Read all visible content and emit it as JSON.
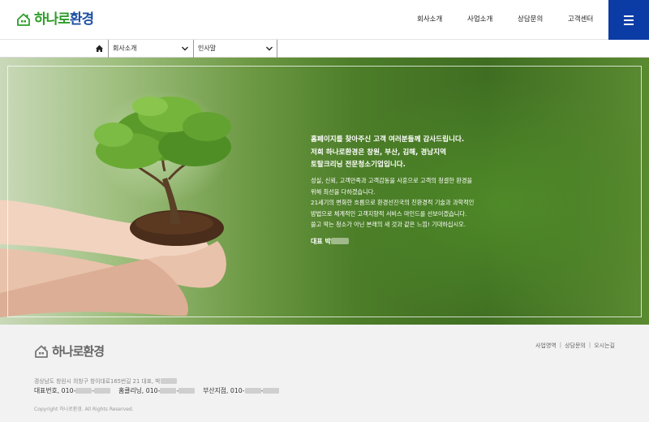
{
  "header": {
    "logo_text": "하나로환경",
    "nav": [
      "회사소개",
      "사업소개",
      "상담문의",
      "고객센터"
    ]
  },
  "subnav": {
    "dropdown1": "회사소개",
    "dropdown2": "인사말"
  },
  "greeting": {
    "headline": [
      "홈페이지를 찾아주신 고객 여러분들께 감사드립니다.",
      "저희 하나로환경은 창원, 부산, 김해, 경남지역",
      "토탈크리닝 전문청소기업입니다."
    ],
    "body": [
      "성실, 신뢰, 고객만족과 고객감동을 사훈으로 고객의 청결한 환경을",
      "위해 최선을 다하겠습니다.",
      "21세기의 변화한 흐름으로 환경선진국의 친환경적 기술과 과학적인",
      "방법으로 체계적인 고객지향적 서비스 마인드를 선보이겠습니다.",
      "쓸고 딱는 청소가 아닌 본래의 새 것과 같은 느낌! 기대하십시오."
    ],
    "sign": "대표 박"
  },
  "footer": {
    "logo_text": "하나로환경",
    "links": [
      "사업영역",
      "상담문의",
      "오시는길"
    ],
    "address": "경상남도 창원시 의창구 창이대로165번길 21   대표, 박",
    "phone1_label": "대표번호, 010-",
    "phone2_label": "홈클리닝, 010-",
    "phone3_label": "부산지점, 010-",
    "copyright": "Copyright 하나로환경. All Rights Reserved."
  },
  "colors": {
    "brand_green": "#2e9d2a",
    "brand_blue": "#1f4fa3",
    "menu_blue": "#0b3ca6"
  }
}
